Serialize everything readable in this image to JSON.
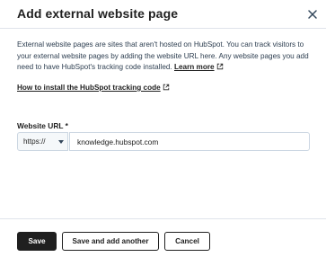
{
  "modal": {
    "title": "Add external website page",
    "close_icon": "close-icon"
  },
  "description": {
    "text": "External website pages are sites that aren't hosted on HubSpot. You can track visitors to your external website pages by adding the website URL here. Any website pages you add need to have HubSpot's tracking code installed.",
    "learn_more": "Learn more",
    "learn_more_icon": "external-link-icon"
  },
  "howto_link": {
    "label": "How to install the HubSpot tracking code",
    "icon": "external-link-icon"
  },
  "url_field": {
    "label": "Website URL *",
    "protocol_selected": "https://",
    "value": "knowledge.hubspot.com"
  },
  "footer": {
    "save": "Save",
    "save_add": "Save and add another",
    "cancel": "Cancel"
  },
  "colors": {
    "text": "#1f1f1f",
    "body_text": "#2d3e50",
    "border": "#cbd6e2",
    "divider": "#dfe3eb",
    "primary_button": "#1f1f1f"
  }
}
